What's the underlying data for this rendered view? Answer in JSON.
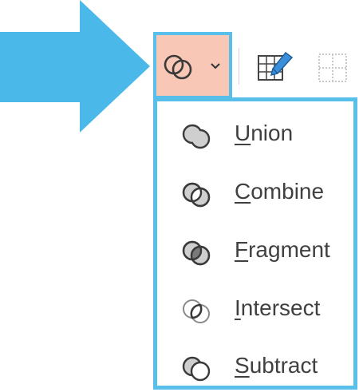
{
  "toolbar": {
    "merge_shapes_icon": "merge-shapes-icon",
    "dropdown_icon": "chevron-down-icon",
    "edit_icon": "edit-shape-icon",
    "gridlines_icon": "gridlines-icon"
  },
  "menu": {
    "items": [
      {
        "label": "Union",
        "accel": "U",
        "rest": "nion",
        "icon": "union-icon"
      },
      {
        "label": "Combine",
        "accel": "C",
        "rest": "ombine",
        "icon": "combine-icon"
      },
      {
        "label": "Fragment",
        "accel": "F",
        "rest": "ragment",
        "icon": "fragment-icon"
      },
      {
        "label": "Intersect",
        "accel": "I",
        "rest": "ntersect",
        "icon": "intersect-icon"
      },
      {
        "label": "Subtract",
        "accel": "S",
        "rest": "ubtract",
        "icon": "subtract-icon"
      }
    ]
  },
  "colors": {
    "highlight_border": "#58bfea",
    "selected_button_bg": "#f9c7b6",
    "arrow": "#4ab8e8",
    "text": "#404040"
  }
}
